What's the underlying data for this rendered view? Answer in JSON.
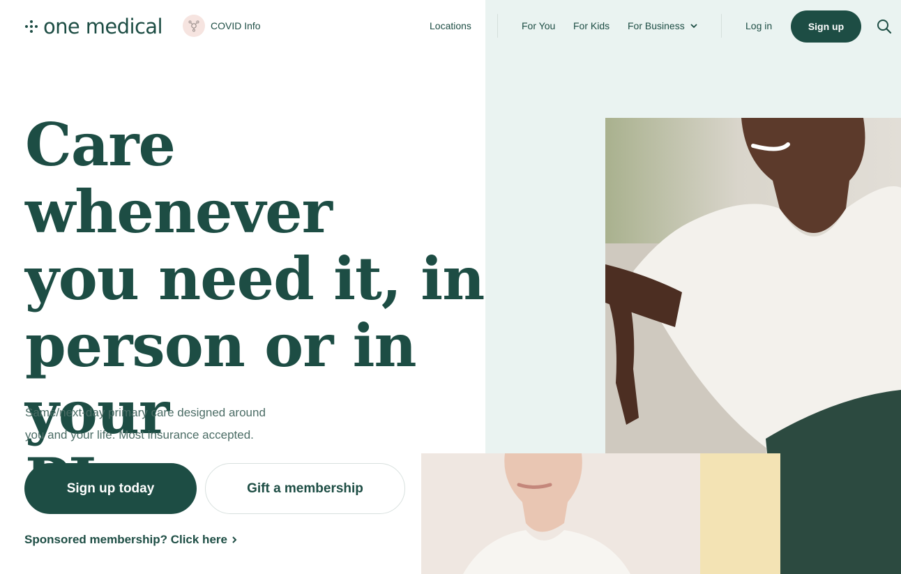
{
  "header": {
    "logo_text": "one medical",
    "covid_label": "COVID Info",
    "nav": {
      "locations": "Locations",
      "for_you": "For You",
      "for_kids": "For Kids",
      "for_business": "For Business",
      "log_in": "Log in",
      "sign_up": "Sign up"
    }
  },
  "hero": {
    "headline_lines": [
      "Care whenever",
      "you need it, in",
      "person or in your",
      "PJs"
    ],
    "subtext_lines": [
      "Same/next-day primary care designed around",
      "you and your life. Most insurance accepted."
    ],
    "primary_cta": "Sign up today",
    "secondary_cta": "Gift a membership",
    "sponsored_link": "Sponsored membership? Click here"
  },
  "colors": {
    "brand_green": "#1d4d44",
    "panel_tint": "#eaf3f1",
    "covid_bubble": "#f6e4e0"
  },
  "icons": [
    "logo-mark-icon",
    "virus-icon",
    "chevron-down-icon",
    "search-icon",
    "chevron-right-icon"
  ]
}
